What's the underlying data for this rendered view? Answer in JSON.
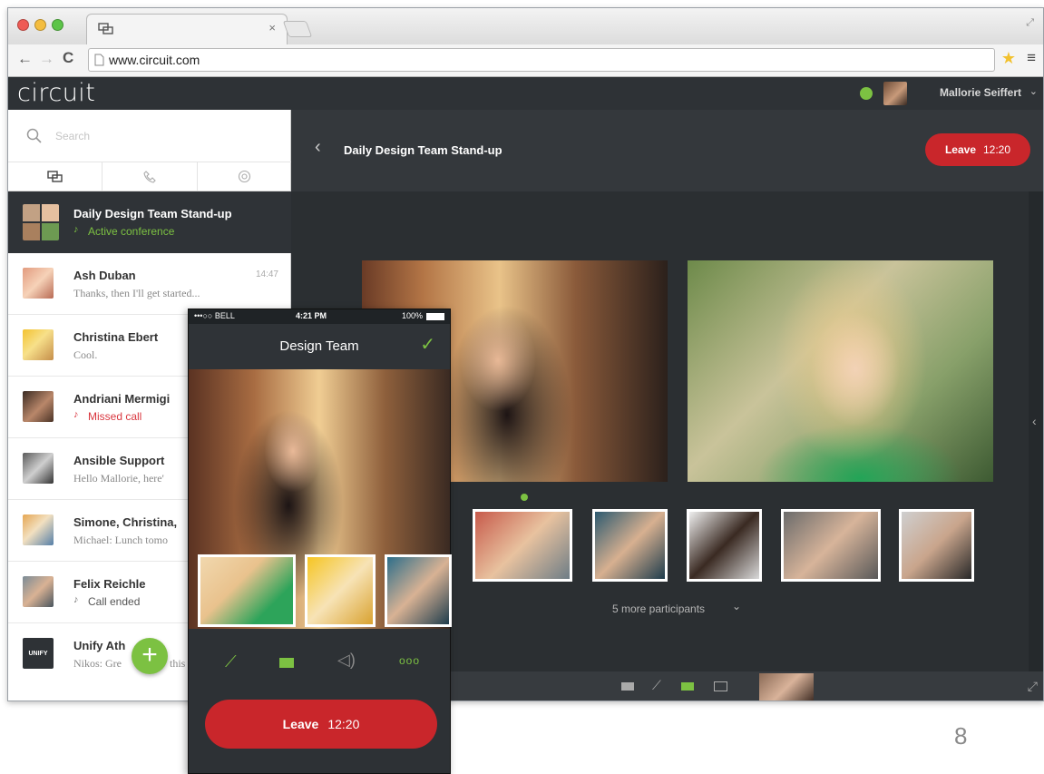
{
  "browser": {
    "url": "www.circuit.com"
  },
  "app": {
    "logo": "circuit",
    "user_name": "Mallorie Seiffert"
  },
  "sidebar": {
    "search_placeholder": "Search",
    "conversations": [
      {
        "name": "Daily Design Team Stand-up",
        "subtitle": "Active conference",
        "time": ""
      },
      {
        "name": "Ash Duban",
        "subtitle": "Thanks, then I'll get started...",
        "time": "14:47"
      },
      {
        "name": "Christina Ebert",
        "subtitle": "Cool.",
        "time": ""
      },
      {
        "name": "Andriani Mermigi",
        "subtitle": "Missed call",
        "time": ""
      },
      {
        "name": "Ansible Support",
        "subtitle": "Hello Mallorie, here'",
        "time": ""
      },
      {
        "name": "Simone, Christina,",
        "subtitle": "Michael: Lunch tomo",
        "time": ""
      },
      {
        "name": "Felix Reichle",
        "subtitle": "Call ended",
        "time": ""
      },
      {
        "name": "Unify Ath",
        "subtitle": "Nikos: Gre",
        "subtitle_tail": "this",
        "time": "",
        "avatar_text": "UNIFY"
      }
    ]
  },
  "conference": {
    "title": "Daily Design Team Stand-up",
    "leave_label": "Leave",
    "timer": "12:20",
    "more_participants": "5 more participants"
  },
  "phone": {
    "status_carrier": "•••○○ BELL",
    "status_time": "4:21 PM",
    "status_battery": "100%",
    "title": "Design Team",
    "leave_label": "Leave",
    "timer": "12:20"
  },
  "slide": {
    "page_number": "8"
  },
  "colors": {
    "accent_green": "#7cc142",
    "leave_red": "#c9262b",
    "missed_red": "#d9363e",
    "dark_bg": "#2b2f32"
  }
}
